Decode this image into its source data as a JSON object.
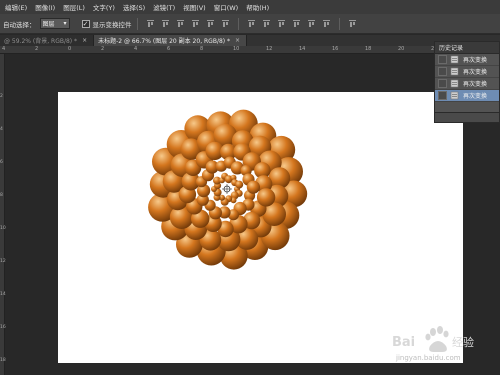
{
  "menu": [
    "编辑(E)",
    "图像(I)",
    "图层(L)",
    "文字(Y)",
    "选择(S)",
    "滤镜(T)",
    "视图(V)",
    "窗口(W)",
    "帮助(H)"
  ],
  "options": {
    "auto_select_label": "自动选择：",
    "auto_select_value": "图层",
    "show_transform_label": "显示变换控件"
  },
  "tabs": [
    {
      "label": "@ 59.2% (背景, RGB/8) *",
      "active": false
    },
    {
      "label": "未标题-2 @ 66.7% (图层 20 副本 20, RGB/8) *",
      "active": true
    }
  ],
  "ruler_top_labels": [
    "4",
    "2",
    "0",
    "2",
    "4",
    "6",
    "8",
    "10",
    "12",
    "14",
    "16",
    "18",
    "20",
    "22",
    "24",
    "26"
  ],
  "ruler_left_labels": [
    "2",
    "4",
    "6",
    "8",
    "10",
    "12",
    "14",
    "16",
    "18"
  ],
  "history_panel": {
    "title": "历史记录",
    "items": [
      {
        "label": "再次变换",
        "selected": false
      },
      {
        "label": "再次变换",
        "selected": false
      },
      {
        "label": "再次变换",
        "selected": false
      },
      {
        "label": "再次变换",
        "selected": true
      }
    ]
  },
  "spiral": {
    "ball_color": "#d4761e",
    "highlight_color": "#f7c98a",
    "shadow_color": "#6e3708"
  },
  "watermark": {
    "brand": "Bai",
    "brand2": "经验",
    "url": "jingyan.baidu.com"
  }
}
